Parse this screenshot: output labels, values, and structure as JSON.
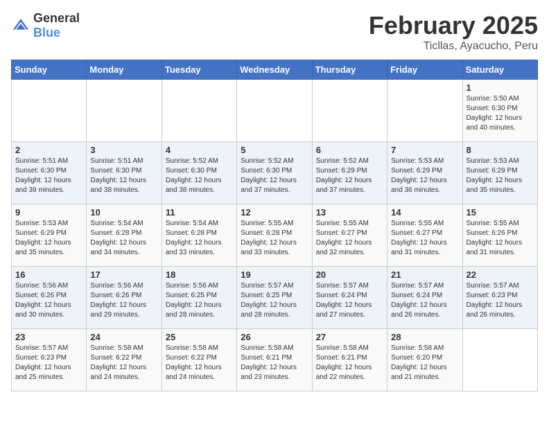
{
  "header": {
    "logo_general": "General",
    "logo_blue": "Blue",
    "month_title": "February 2025",
    "location": "Ticllas, Ayacucho, Peru"
  },
  "weekdays": [
    "Sunday",
    "Monday",
    "Tuesday",
    "Wednesday",
    "Thursday",
    "Friday",
    "Saturday"
  ],
  "weeks": [
    [
      {
        "day": "",
        "info": ""
      },
      {
        "day": "",
        "info": ""
      },
      {
        "day": "",
        "info": ""
      },
      {
        "day": "",
        "info": ""
      },
      {
        "day": "",
        "info": ""
      },
      {
        "day": "",
        "info": ""
      },
      {
        "day": "1",
        "info": "Sunrise: 5:50 AM\nSunset: 6:30 PM\nDaylight: 12 hours\nand 40 minutes."
      }
    ],
    [
      {
        "day": "2",
        "info": "Sunrise: 5:51 AM\nSunset: 6:30 PM\nDaylight: 12 hours\nand 39 minutes."
      },
      {
        "day": "3",
        "info": "Sunrise: 5:51 AM\nSunset: 6:30 PM\nDaylight: 12 hours\nand 38 minutes."
      },
      {
        "day": "4",
        "info": "Sunrise: 5:52 AM\nSunset: 6:30 PM\nDaylight: 12 hours\nand 38 minutes."
      },
      {
        "day": "5",
        "info": "Sunrise: 5:52 AM\nSunset: 6:30 PM\nDaylight: 12 hours\nand 37 minutes."
      },
      {
        "day": "6",
        "info": "Sunrise: 5:52 AM\nSunset: 6:29 PM\nDaylight: 12 hours\nand 37 minutes."
      },
      {
        "day": "7",
        "info": "Sunrise: 5:53 AM\nSunset: 6:29 PM\nDaylight: 12 hours\nand 36 minutes."
      },
      {
        "day": "8",
        "info": "Sunrise: 5:53 AM\nSunset: 6:29 PM\nDaylight: 12 hours\nand 35 minutes."
      }
    ],
    [
      {
        "day": "9",
        "info": "Sunrise: 5:53 AM\nSunset: 6:29 PM\nDaylight: 12 hours\nand 35 minutes."
      },
      {
        "day": "10",
        "info": "Sunrise: 5:54 AM\nSunset: 6:28 PM\nDaylight: 12 hours\nand 34 minutes."
      },
      {
        "day": "11",
        "info": "Sunrise: 5:54 AM\nSunset: 6:28 PM\nDaylight: 12 hours\nand 33 minutes."
      },
      {
        "day": "12",
        "info": "Sunrise: 5:55 AM\nSunset: 6:28 PM\nDaylight: 12 hours\nand 33 minutes."
      },
      {
        "day": "13",
        "info": "Sunrise: 5:55 AM\nSunset: 6:27 PM\nDaylight: 12 hours\nand 32 minutes."
      },
      {
        "day": "14",
        "info": "Sunrise: 5:55 AM\nSunset: 6:27 PM\nDaylight: 12 hours\nand 31 minutes."
      },
      {
        "day": "15",
        "info": "Sunrise: 5:55 AM\nSunset: 6:26 PM\nDaylight: 12 hours\nand 31 minutes."
      }
    ],
    [
      {
        "day": "16",
        "info": "Sunrise: 5:56 AM\nSunset: 6:26 PM\nDaylight: 12 hours\nand 30 minutes."
      },
      {
        "day": "17",
        "info": "Sunrise: 5:56 AM\nSunset: 6:26 PM\nDaylight: 12 hours\nand 29 minutes."
      },
      {
        "day": "18",
        "info": "Sunrise: 5:56 AM\nSunset: 6:25 PM\nDaylight: 12 hours\nand 28 minutes."
      },
      {
        "day": "19",
        "info": "Sunrise: 5:57 AM\nSunset: 6:25 PM\nDaylight: 12 hours\nand 28 minutes."
      },
      {
        "day": "20",
        "info": "Sunrise: 5:57 AM\nSunset: 6:24 PM\nDaylight: 12 hours\nand 27 minutes."
      },
      {
        "day": "21",
        "info": "Sunrise: 5:57 AM\nSunset: 6:24 PM\nDaylight: 12 hours\nand 26 minutes."
      },
      {
        "day": "22",
        "info": "Sunrise: 5:57 AM\nSunset: 6:23 PM\nDaylight: 12 hours\nand 26 minutes."
      }
    ],
    [
      {
        "day": "23",
        "info": "Sunrise: 5:57 AM\nSunset: 6:23 PM\nDaylight: 12 hours\nand 25 minutes."
      },
      {
        "day": "24",
        "info": "Sunrise: 5:58 AM\nSunset: 6:22 PM\nDaylight: 12 hours\nand 24 minutes."
      },
      {
        "day": "25",
        "info": "Sunrise: 5:58 AM\nSunset: 6:22 PM\nDaylight: 12 hours\nand 24 minutes."
      },
      {
        "day": "26",
        "info": "Sunrise: 5:58 AM\nSunset: 6:21 PM\nDaylight: 12 hours\nand 23 minutes."
      },
      {
        "day": "27",
        "info": "Sunrise: 5:58 AM\nSunset: 6:21 PM\nDaylight: 12 hours\nand 22 minutes."
      },
      {
        "day": "28",
        "info": "Sunrise: 5:58 AM\nSunset: 6:20 PM\nDaylight: 12 hours\nand 21 minutes."
      },
      {
        "day": "",
        "info": ""
      }
    ]
  ]
}
